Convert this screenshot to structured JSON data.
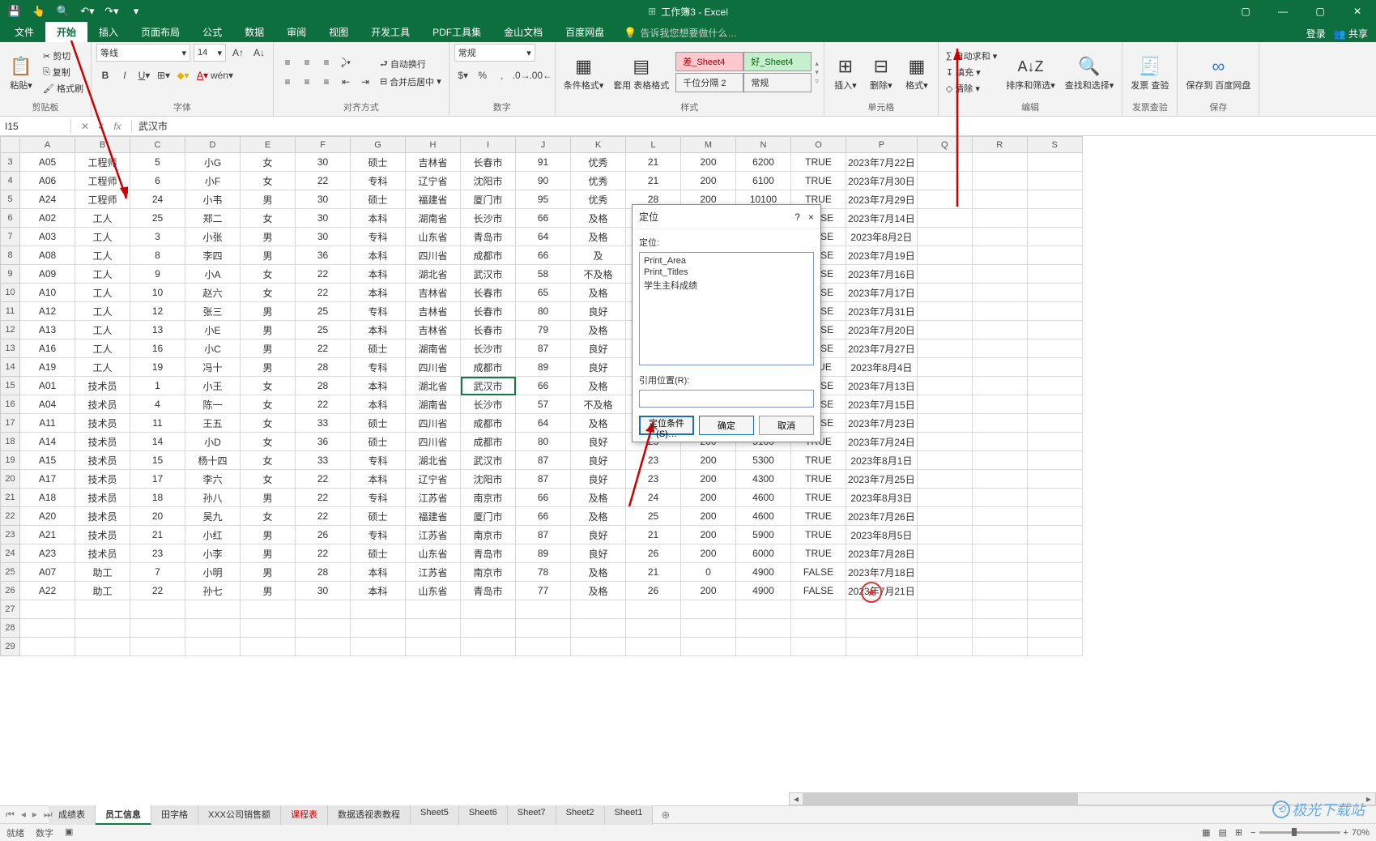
{
  "window_title": "工作簿3 - Excel",
  "titlebar": {
    "login": "登录",
    "share": "共享"
  },
  "qat": [
    "save-icon",
    "touch-icon",
    "print-preview-icon",
    "undo-icon",
    "redo-icon"
  ],
  "menu_tabs": [
    "文件",
    "开始",
    "插入",
    "页面布局",
    "公式",
    "数据",
    "审阅",
    "视图",
    "开发工具",
    "PDF工具集",
    "金山文档",
    "百度网盘"
  ],
  "active_tab": 1,
  "tell_me": "告诉我您想要做什么…",
  "ribbon": {
    "clipboard": {
      "paste": "粘贴",
      "cut": "剪切",
      "copy": "复制",
      "format_painter": "格式刷",
      "group": "剪贴板"
    },
    "font": {
      "name": "等线",
      "size": "14",
      "group": "字体"
    },
    "align": {
      "wrap": "自动换行",
      "merge": "合并后居中",
      "group": "对齐方式"
    },
    "number": {
      "format": "常规",
      "group": "数字"
    },
    "styles": {
      "cond": "条件格式",
      "table_fmt": "套用\n表格格式",
      "bad": "差_Sheet4",
      "good": "好_Sheet4",
      "thousand": "千位分隔 2",
      "normal": "常规",
      "group": "样式"
    },
    "cells": {
      "insert": "插入",
      "delete": "删除",
      "format": "格式",
      "group": "单元格"
    },
    "editing": {
      "autosum": "自动求和",
      "fill": "填充",
      "clear": "清除",
      "sort": "排序和筛选",
      "find": "查找和选择",
      "group": "编辑"
    },
    "invoice": {
      "label": "发票\n查验",
      "group": "发票查验"
    },
    "baidu": {
      "label": "保存到\n百度网盘",
      "group": "保存"
    }
  },
  "namebox": "I15",
  "formula": "武汉市",
  "columns": [
    "A",
    "B",
    "C",
    "D",
    "E",
    "F",
    "G",
    "H",
    "I",
    "J",
    "K",
    "L",
    "M",
    "N",
    "O",
    "P",
    "Q",
    "R",
    "S"
  ],
  "row_numbers": [
    3,
    4,
    5,
    6,
    7,
    8,
    9,
    10,
    11,
    12,
    13,
    14,
    15,
    16,
    17,
    18,
    19,
    20,
    21,
    22,
    23,
    24,
    25,
    26,
    27,
    28,
    29
  ],
  "selected_cell": {
    "row": 15,
    "col": "I"
  },
  "rows": [
    [
      "A05",
      "工程师",
      "5",
      "小G",
      "女",
      "30",
      "硕士",
      "吉林省",
      "长春市",
      "91",
      "优秀",
      "21",
      "200",
      "6200",
      "TRUE",
      "2023年7月22日"
    ],
    [
      "A06",
      "工程师",
      "6",
      "小F",
      "女",
      "22",
      "专科",
      "辽宁省",
      "沈阳市",
      "90",
      "优秀",
      "21",
      "200",
      "6100",
      "TRUE",
      "2023年7月30日"
    ],
    [
      "A24",
      "工程师",
      "24",
      "小韦",
      "男",
      "30",
      "硕士",
      "福建省",
      "厦门市",
      "95",
      "优秀",
      "28",
      "200",
      "10100",
      "TRUE",
      "2023年7月29日"
    ],
    [
      "A02",
      "工人",
      "25",
      "郑二",
      "女",
      "30",
      "本科",
      "湖南省",
      "长沙市",
      "66",
      "及格",
      "",
      "",
      "",
      "FALSE",
      "2023年7月14日"
    ],
    [
      "A03",
      "工人",
      "3",
      "小张",
      "男",
      "30",
      "专科",
      "山东省",
      "青岛市",
      "64",
      "及格",
      "",
      "",
      "",
      "FALSE",
      "2023年8月2日"
    ],
    [
      "A08",
      "工人",
      "8",
      "李四",
      "男",
      "36",
      "本科",
      "四川省",
      "成都市",
      "66",
      "及",
      "",
      "",
      "",
      "FALSE",
      "2023年7月19日"
    ],
    [
      "A09",
      "工人",
      "9",
      "小A",
      "女",
      "22",
      "本科",
      "湖北省",
      "武汉市",
      "58",
      "不及格",
      "",
      "",
      "",
      "FALSE",
      "2023年7月16日"
    ],
    [
      "A10",
      "工人",
      "10",
      "赵六",
      "女",
      "22",
      "本科",
      "吉林省",
      "长春市",
      "65",
      "及格",
      "",
      "",
      "",
      "FALSE",
      "2023年7月17日"
    ],
    [
      "A12",
      "工人",
      "12",
      "张三",
      "男",
      "25",
      "专科",
      "吉林省",
      "长春市",
      "80",
      "良好",
      "",
      "",
      "",
      "FALSE",
      "2023年7月31日"
    ],
    [
      "A13",
      "工人",
      "13",
      "小E",
      "男",
      "25",
      "本科",
      "吉林省",
      "长春市",
      "79",
      "及格",
      "",
      "",
      "",
      "FALSE",
      "2023年7月20日"
    ],
    [
      "A16",
      "工人",
      "16",
      "小C",
      "男",
      "22",
      "硕士",
      "湖南省",
      "长沙市",
      "87",
      "良好",
      "",
      "",
      "",
      "FALSE",
      "2023年7月27日"
    ],
    [
      "A19",
      "工人",
      "19",
      "冯十",
      "男",
      "28",
      "专科",
      "四川省",
      "成都市",
      "89",
      "良好",
      "",
      "",
      "",
      "TRUE",
      "2023年8月4日"
    ],
    [
      "A01",
      "技术员",
      "1",
      "小王",
      "女",
      "28",
      "本科",
      "湖北省",
      "武汉市",
      "66",
      "及格",
      "",
      "",
      "",
      "FALSE",
      "2023年7月13日"
    ],
    [
      "A04",
      "技术员",
      "4",
      "陈一",
      "女",
      "22",
      "本科",
      "湖南省",
      "长沙市",
      "57",
      "不及格",
      "",
      "",
      "",
      "FALSE",
      "2023年7月15日"
    ],
    [
      "A11",
      "技术员",
      "11",
      "王五",
      "女",
      "33",
      "硕士",
      "四川省",
      "成都市",
      "64",
      "及格",
      "",
      "",
      "",
      "FALSE",
      "2023年7月23日"
    ],
    [
      "A14",
      "技术员",
      "14",
      "小D",
      "女",
      "36",
      "硕士",
      "四川省",
      "成都市",
      "80",
      "良好",
      "23",
      "200",
      "5100",
      "TRUE",
      "2023年7月24日"
    ],
    [
      "A15",
      "技术员",
      "15",
      "杨十四",
      "女",
      "33",
      "专科",
      "湖北省",
      "武汉市",
      "87",
      "良好",
      "23",
      "200",
      "5300",
      "TRUE",
      "2023年8月1日"
    ],
    [
      "A17",
      "技术员",
      "17",
      "李六",
      "女",
      "22",
      "本科",
      "辽宁省",
      "沈阳市",
      "87",
      "良好",
      "23",
      "200",
      "4300",
      "TRUE",
      "2023年7月25日"
    ],
    [
      "A18",
      "技术员",
      "18",
      "孙八",
      "男",
      "22",
      "专科",
      "江苏省",
      "南京市",
      "66",
      "及格",
      "24",
      "200",
      "4600",
      "TRUE",
      "2023年8月3日"
    ],
    [
      "A20",
      "技术员",
      "20",
      "吴九",
      "女",
      "22",
      "硕士",
      "福建省",
      "厦门市",
      "66",
      "及格",
      "25",
      "200",
      "4600",
      "TRUE",
      "2023年7月26日"
    ],
    [
      "A21",
      "技术员",
      "21",
      "小红",
      "男",
      "26",
      "专科",
      "江苏省",
      "南京市",
      "87",
      "良好",
      "21",
      "200",
      "5900",
      "TRUE",
      "2023年8月5日"
    ],
    [
      "A23",
      "技术员",
      "23",
      "小李",
      "男",
      "22",
      "硕士",
      "山东省",
      "青岛市",
      "89",
      "良好",
      "26",
      "200",
      "6000",
      "TRUE",
      "2023年7月28日"
    ],
    [
      "A07",
      "助工",
      "7",
      "小明",
      "男",
      "28",
      "本科",
      "江苏省",
      "南京市",
      "78",
      "及格",
      "21",
      "0",
      "4900",
      "FALSE",
      "2023年7月18日"
    ],
    [
      "A22",
      "助工",
      "22",
      "孙七",
      "男",
      "30",
      "本科",
      "山东省",
      "青岛市",
      "77",
      "及格",
      "26",
      "200",
      "4900",
      "FALSE",
      "2023年7月21日"
    ],
    [
      "",
      "",
      "",
      "",
      "",
      "",
      "",
      "",
      "",
      "",
      "",
      "",
      "",
      "",
      "",
      ""
    ],
    [
      "",
      "",
      "",
      "",
      "",
      "",
      "",
      "",
      "",
      "",
      "",
      "",
      "",
      "",
      "",
      ""
    ],
    [
      "",
      "",
      "",
      "",
      "",
      "",
      "",
      "",
      "",
      "",
      "",
      "",
      "",
      "",
      "",
      ""
    ]
  ],
  "sheettabs": [
    "成绩表",
    "员工信息",
    "田字格",
    "XXX公司销售额",
    "课程表",
    "数据透视表教程",
    "Sheet5",
    "Sheet6",
    "Sheet7",
    "Sheet2",
    "Sheet1"
  ],
  "active_sheet": 1,
  "dialog": {
    "title": "定位",
    "help": "?",
    "close": "×",
    "list_label": "定位:",
    "items": [
      "Print_Area",
      "Print_Titles",
      "学生主科成绩"
    ],
    "ref_label": "引用位置(R):",
    "btn_special": "定位条件(S)…",
    "btn_ok": "确定",
    "btn_cancel": "取消"
  },
  "status": {
    "ready": "就绪",
    "mode": "数字",
    "zoom": "70%"
  },
  "watermark": "极光下载站"
}
